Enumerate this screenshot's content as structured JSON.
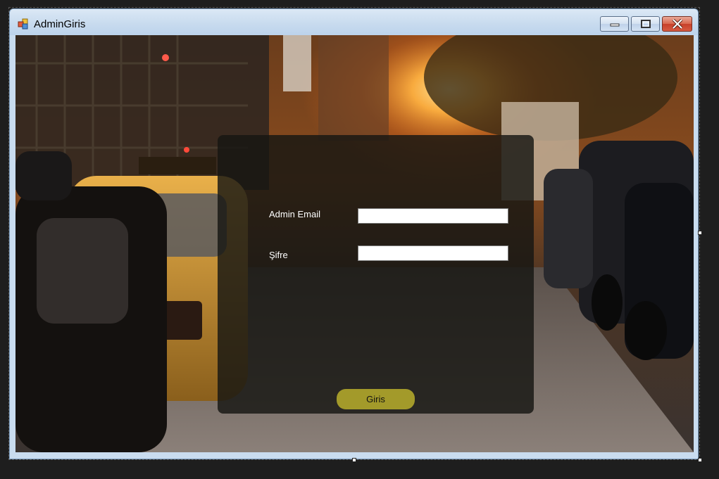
{
  "window": {
    "title": "AdminGiris",
    "icon": "winforms-app-icon",
    "controls": [
      "minimize-icon",
      "maximize-icon",
      "close-icon"
    ]
  },
  "background": {
    "description_icon": "city-street-taxi-background-image"
  },
  "login_form": {
    "email_label": "Admin Email",
    "email_value": "",
    "password_label": "Şifre",
    "password_value": "",
    "submit_label": "Giris"
  },
  "colors": {
    "panel": "#161612",
    "button": "#a39a2a",
    "titlebar": "#c9dcef",
    "close": "#d65a41"
  }
}
